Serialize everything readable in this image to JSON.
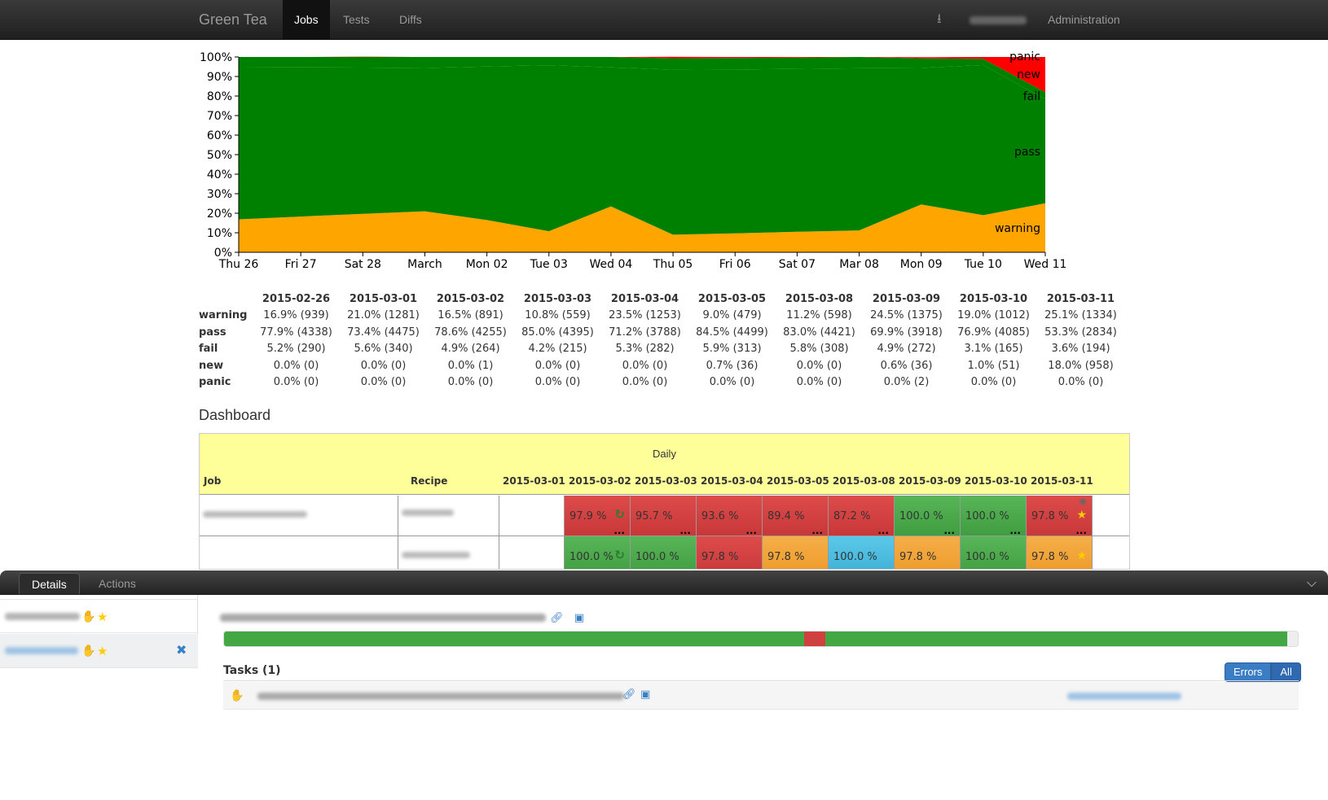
{
  "navbar": {
    "brand": "Green Tea",
    "tabs": [
      {
        "label": "Jobs",
        "active": true
      },
      {
        "label": "Tests",
        "active": false
      },
      {
        "label": "Diffs",
        "active": false
      }
    ],
    "admin": "Administration",
    "logout_icon": "logout-icon"
  },
  "chart_data": {
    "type": "area",
    "stacked": true,
    "normalized": true,
    "x": [
      "Thu 26",
      "Fri 27",
      "Sat 28",
      "March",
      "Mon 02",
      "Tue 03",
      "Wed 04",
      "Thu 05",
      "Fri 06",
      "Sat 07",
      "Mar 08",
      "Mon 09",
      "Tue 10",
      "Wed 11"
    ],
    "x_dates": [
      "2015-02-26",
      "2015-02-27",
      "2015-02-28",
      "2015-03-01",
      "2015-03-02",
      "2015-03-03",
      "2015-03-04",
      "2015-03-05",
      "2015-03-06",
      "2015-03-07",
      "2015-03-08",
      "2015-03-09",
      "2015-03-10",
      "2015-03-11"
    ],
    "ylim": [
      0,
      100
    ],
    "yticks": [
      "0%",
      "10%",
      "20%",
      "30%",
      "40%",
      "50%",
      "60%",
      "70%",
      "80%",
      "90%",
      "100%"
    ],
    "series": [
      {
        "name": "warning",
        "color": "#ffa500",
        "values": [
          16.9,
          18.3,
          19.7,
          21.0,
          16.5,
          10.8,
          23.5,
          9.0,
          9.7,
          10.5,
          11.2,
          24.5,
          19.0,
          25.1
        ]
      },
      {
        "name": "pass",
        "color": "#008000",
        "values": [
          77.9,
          76.4,
          74.9,
          73.4,
          78.6,
          85.0,
          71.2,
          84.5,
          83.9,
          83.4,
          83.0,
          69.9,
          76.9,
          53.3
        ]
      },
      {
        "name": "fail",
        "color": "#008000",
        "values": [
          5.2,
          5.3,
          5.5,
          5.6,
          4.9,
          4.2,
          5.3,
          5.9,
          5.9,
          5.8,
          5.8,
          4.9,
          3.1,
          3.6
        ]
      },
      {
        "name": "new",
        "color": "#ff0000",
        "values": [
          0,
          0,
          0,
          0,
          0,
          0,
          0,
          0.7,
          0.5,
          0.3,
          0,
          0.6,
          1.0,
          18.0
        ]
      },
      {
        "name": "panic",
        "color": "#ff0000",
        "values": [
          0,
          0,
          0,
          0,
          0,
          0,
          0,
          0,
          0,
          0,
          0,
          0,
          0,
          0
        ]
      }
    ],
    "legend_labels": [
      "panic",
      "new",
      "fail",
      "pass",
      "warning"
    ]
  },
  "stats": {
    "dates": [
      "2015-02-26",
      "2015-03-01",
      "2015-03-02",
      "2015-03-03",
      "2015-03-04",
      "2015-03-05",
      "2015-03-08",
      "2015-03-09",
      "2015-03-10",
      "2015-03-11"
    ],
    "rows": [
      {
        "label": "warning",
        "cells": [
          "16.9% (939)",
          "21.0% (1281)",
          "16.5% (891)",
          "10.8% (559)",
          "23.5% (1253)",
          "9.0% (479)",
          "11.2% (598)",
          "24.5% (1375)",
          "19.0% (1012)",
          "25.1% (1334)"
        ]
      },
      {
        "label": "pass",
        "cells": [
          "77.9% (4338)",
          "73.4% (4475)",
          "78.6% (4255)",
          "85.0% (4395)",
          "71.2% (3788)",
          "84.5% (4499)",
          "83.0% (4421)",
          "69.9% (3918)",
          "76.9% (4085)",
          "53.3% (2834)"
        ]
      },
      {
        "label": "fail",
        "cells": [
          "5.2% (290)",
          "5.6% (340)",
          "4.9% (264)",
          "4.2% (215)",
          "5.3% (282)",
          "5.9% (313)",
          "5.8% (308)",
          "4.9% (272)",
          "3.1% (165)",
          "3.6% (194)"
        ]
      },
      {
        "label": "new",
        "cells": [
          "0.0% (0)",
          "0.0% (0)",
          "0.0% (1)",
          "0.0% (0)",
          "0.0% (0)",
          "0.7% (36)",
          "0.0% (0)",
          "0.6% (36)",
          "1.0% (51)",
          "18.0% (958)"
        ]
      },
      {
        "label": "panic",
        "cells": [
          "0.0% (0)",
          "0.0% (0)",
          "0.0% (0)",
          "0.0% (0)",
          "0.0% (0)",
          "0.0% (0)",
          "0.0% (0)",
          "0.0% (2)",
          "0.0% (0)",
          "0.0% (0)"
        ]
      }
    ]
  },
  "dashboard": {
    "title": "Dashboard",
    "group": "Daily",
    "col_job": "Job",
    "col_recipe": "Recipe",
    "dates": [
      "2015-03-01",
      "2015-03-02",
      "2015-03-03",
      "2015-03-04",
      "2015-03-05",
      "2015-03-08",
      "2015-03-09",
      "2015-03-10",
      "2015-03-11"
    ],
    "rows": [
      {
        "cells": [
          null,
          {
            "v": "97.9 %",
            "c": "red",
            "refresh": true
          },
          {
            "v": "95.7 %",
            "c": "red"
          },
          {
            "v": "93.6 %",
            "c": "red"
          },
          {
            "v": "89.4 %",
            "c": "red"
          },
          {
            "v": "87.2 %",
            "c": "red"
          },
          {
            "v": "100.0 %",
            "c": "green"
          },
          {
            "v": "100.0 %",
            "c": "green"
          },
          {
            "v": "97.8 %",
            "c": "red",
            "star": true,
            "eye": true
          }
        ]
      },
      {
        "cells": [
          null,
          {
            "v": "100.0 %",
            "c": "green",
            "refresh": true
          },
          {
            "v": "100.0 %",
            "c": "green"
          },
          {
            "v": "97.8 %",
            "c": "red"
          },
          {
            "v": "97.8 %",
            "c": "orange"
          },
          {
            "v": "100.0 %",
            "c": "blue"
          },
          {
            "v": "97.8 %",
            "c": "orange"
          },
          {
            "v": "100.0 %",
            "c": "green"
          },
          {
            "v": "97.8 %",
            "c": "orange",
            "star": true
          }
        ]
      }
    ],
    "dots": "..."
  },
  "panel": {
    "tabs": [
      "Details",
      "Actions"
    ],
    "tasks_title": "Tasks (1)",
    "btn_errors": "Errors",
    "btn_all": "All",
    "progress": [
      {
        "from": 0,
        "to": 0.54,
        "color": "#43a843"
      },
      {
        "from": 0.54,
        "to": 0.56,
        "color": "#d04040"
      },
      {
        "from": 0.56,
        "to": 0.99,
        "color": "#43a843"
      }
    ]
  }
}
